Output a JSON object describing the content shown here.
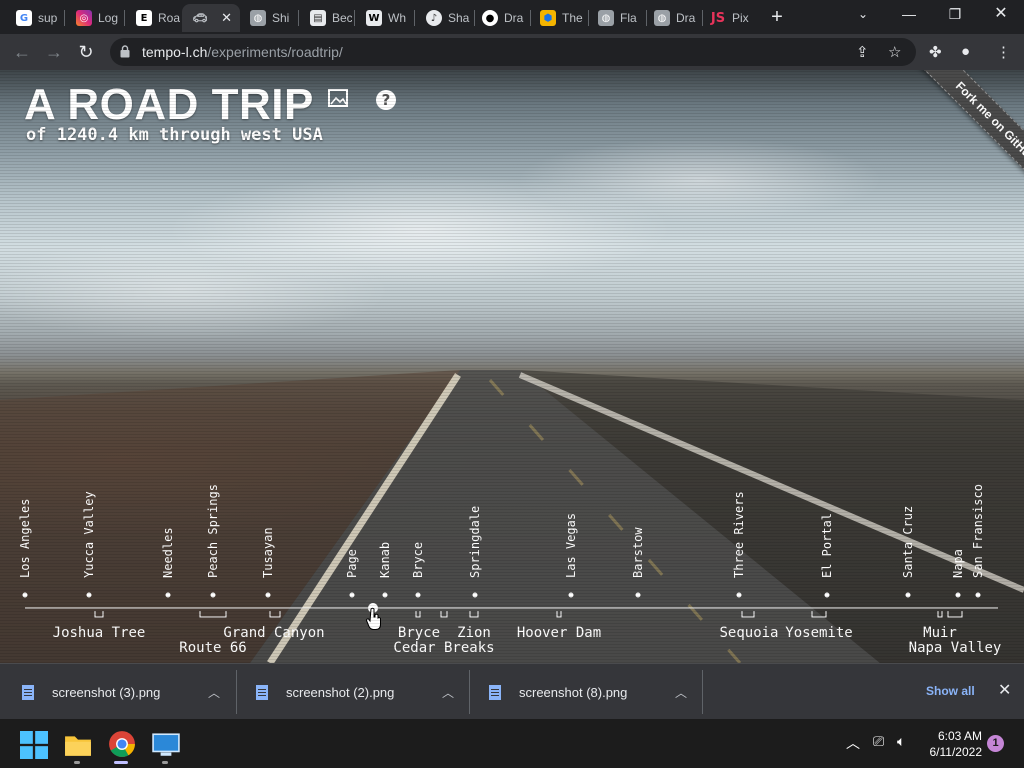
{
  "browser": {
    "tabs": [
      {
        "label": "sup",
        "favicon": "google-icon"
      },
      {
        "label": "Log",
        "favicon": "instagram-icon"
      },
      {
        "label": "Roa",
        "favicon": "e-icon"
      },
      {
        "label": "",
        "favicon": "car-icon",
        "active": true
      },
      {
        "label": "Shi",
        "favicon": "globe-icon"
      },
      {
        "label": "Bec",
        "favicon": "bec-icon"
      },
      {
        "label": "Wh",
        "favicon": "w-icon"
      },
      {
        "label": "Sha",
        "favicon": "sha-icon"
      },
      {
        "label": "Dra",
        "favicon": "github-icon"
      },
      {
        "label": "The",
        "favicon": "hexagon-icon"
      },
      {
        "label": "Fla",
        "favicon": "globe-icon"
      },
      {
        "label": "Dra",
        "favicon": "globe-icon"
      },
      {
        "label": "Pix",
        "favicon": "js-icon"
      }
    ],
    "url_host": "tempo-l.ch",
    "url_path": "/experiments/roadtrip/"
  },
  "page": {
    "title": "A ROAD TRIP",
    "subtitle": "of 1240.4 km through west USA",
    "ribbon": "Fork me on GitHub"
  },
  "timeline": {
    "stops": [
      {
        "name": "Los Angeles"
      },
      {
        "name": "Yucca Valley"
      },
      {
        "name": "Needles"
      },
      {
        "name": "Peach Springs"
      },
      {
        "name": "Tusayan"
      },
      {
        "name": "Page"
      },
      {
        "name": "Kanab"
      },
      {
        "name": "Bryce"
      },
      {
        "name": "Springdale"
      },
      {
        "name": "Las Vegas"
      },
      {
        "name": "Barstow"
      },
      {
        "name": "Three Rivers"
      },
      {
        "name": "El Portal"
      },
      {
        "name": "Santa Cruz"
      },
      {
        "name": "Napa"
      },
      {
        "name": "San Fransisco"
      }
    ],
    "sights": [
      {
        "name": "Joshua Tree"
      },
      {
        "name": "Route 66"
      },
      {
        "name": "Grand Canyon"
      },
      {
        "name": "Bryce"
      },
      {
        "name": "Zion"
      },
      {
        "name": "Cedar Breaks"
      },
      {
        "name": "Hoover Dam"
      },
      {
        "name": "Sequoia"
      },
      {
        "name": "Yosemite"
      },
      {
        "name": "Muir"
      },
      {
        "name": "Napa Valley"
      }
    ]
  },
  "downloads": {
    "items": [
      {
        "filename": "screenshot (3).png"
      },
      {
        "filename": "screenshot (2).png"
      },
      {
        "filename": "screenshot (8).png"
      }
    ],
    "show_all": "Show all"
  },
  "taskbar": {
    "time": "6:03 AM",
    "date": "6/11/2022",
    "notifications": "1"
  }
}
